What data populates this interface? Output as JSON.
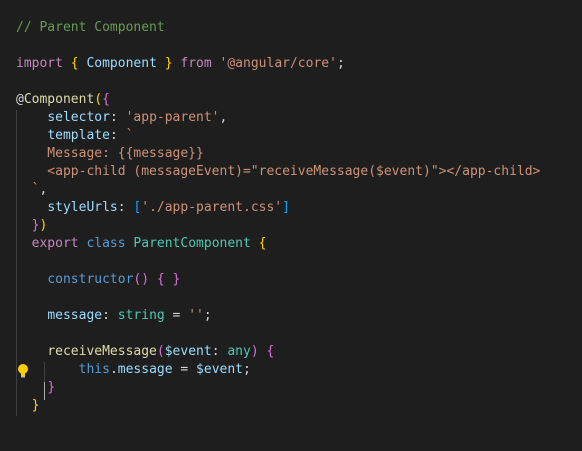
{
  "editor": {
    "lines": [
      {
        "id": "l1",
        "tokens": [
          {
            "t": "// Parent Component",
            "c": "comment"
          }
        ]
      },
      {
        "id": "l2",
        "tokens": []
      },
      {
        "id": "l3",
        "tokens": [
          {
            "t": "import",
            "c": "keyword"
          },
          {
            "t": " ",
            "c": "punct"
          },
          {
            "t": "{",
            "c": "brace-gold"
          },
          {
            "t": " ",
            "c": "punct"
          },
          {
            "t": "Component",
            "c": "var"
          },
          {
            "t": " ",
            "c": "punct"
          },
          {
            "t": "}",
            "c": "brace-gold"
          },
          {
            "t": " ",
            "c": "punct"
          },
          {
            "t": "from",
            "c": "keyword"
          },
          {
            "t": " ",
            "c": "punct"
          },
          {
            "t": "'@angular/core'",
            "c": "string"
          },
          {
            "t": ";",
            "c": "punct"
          }
        ]
      },
      {
        "id": "l4",
        "tokens": []
      },
      {
        "id": "l5",
        "tokens": [
          {
            "t": "@",
            "c": "punct"
          },
          {
            "t": "Component",
            "c": "decorator"
          },
          {
            "t": "(",
            "c": "brace-gold"
          },
          {
            "t": "{",
            "c": "brace-purple"
          }
        ]
      },
      {
        "id": "l6",
        "tokens": [
          {
            "t": "    ",
            "c": "punct"
          },
          {
            "t": "selector",
            "c": "var"
          },
          {
            "t": ": ",
            "c": "punct"
          },
          {
            "t": "'app-parent'",
            "c": "string"
          },
          {
            "t": ",",
            "c": "punct"
          }
        ]
      },
      {
        "id": "l7",
        "tokens": [
          {
            "t": "    ",
            "c": "punct"
          },
          {
            "t": "template",
            "c": "var"
          },
          {
            "t": ": ",
            "c": "punct"
          },
          {
            "t": "`",
            "c": "string"
          }
        ]
      },
      {
        "id": "l8",
        "tokens": [
          {
            "t": "    Message: {{message}}",
            "c": "string"
          }
        ]
      },
      {
        "id": "l9",
        "tokens": [
          {
            "t": "    <app-child (messageEvent)=\"receiveMessage($event)\"></app-child>",
            "c": "string"
          }
        ]
      },
      {
        "id": "l10",
        "tokens": [
          {
            "t": "  `",
            "c": "string"
          },
          {
            "t": ",",
            "c": "punct"
          }
        ]
      },
      {
        "id": "l11",
        "tokens": [
          {
            "t": "    ",
            "c": "punct"
          },
          {
            "t": "styleUrls",
            "c": "var"
          },
          {
            "t": ": ",
            "c": "punct"
          },
          {
            "t": "[",
            "c": "brace-blue"
          },
          {
            "t": "'./app-parent.css'",
            "c": "string"
          },
          {
            "t": "]",
            "c": "brace-blue"
          }
        ]
      },
      {
        "id": "l12",
        "tokens": [
          {
            "t": "  ",
            "c": "punct"
          },
          {
            "t": "}",
            "c": "brace-purple"
          },
          {
            "t": ")",
            "c": "brace-gold"
          }
        ]
      },
      {
        "id": "l13",
        "tokens": [
          {
            "t": "  ",
            "c": "punct"
          },
          {
            "t": "export",
            "c": "keyword"
          },
          {
            "t": " ",
            "c": "punct"
          },
          {
            "t": "class",
            "c": "storage"
          },
          {
            "t": " ",
            "c": "punct"
          },
          {
            "t": "ParentComponent",
            "c": "class"
          },
          {
            "t": " ",
            "c": "punct"
          },
          {
            "t": "{",
            "c": "brace-gold"
          }
        ]
      },
      {
        "id": "l14",
        "tokens": []
      },
      {
        "id": "l15",
        "tokens": [
          {
            "t": "    ",
            "c": "punct"
          },
          {
            "t": "constructor",
            "c": "storage"
          },
          {
            "t": "()",
            "c": "brace-purple"
          },
          {
            "t": " ",
            "c": "punct"
          },
          {
            "t": "{",
            "c": "brace-purple"
          },
          {
            "t": " ",
            "c": "punct"
          },
          {
            "t": "}",
            "c": "brace-purple"
          }
        ]
      },
      {
        "id": "l16",
        "tokens": []
      },
      {
        "id": "l17",
        "tokens": [
          {
            "t": "    ",
            "c": "punct"
          },
          {
            "t": "message",
            "c": "var"
          },
          {
            "t": ": ",
            "c": "punct"
          },
          {
            "t": "string",
            "c": "class"
          },
          {
            "t": " = ",
            "c": "punct"
          },
          {
            "t": "''",
            "c": "string"
          },
          {
            "t": ";",
            "c": "punct"
          }
        ]
      },
      {
        "id": "l18",
        "tokens": []
      },
      {
        "id": "l19",
        "tokens": [
          {
            "t": "    ",
            "c": "punct"
          },
          {
            "t": "receiveMessage",
            "c": "fn"
          },
          {
            "t": "(",
            "c": "brace-purple"
          },
          {
            "t": "$event",
            "c": "var"
          },
          {
            "t": ": ",
            "c": "punct"
          },
          {
            "t": "any",
            "c": "class"
          },
          {
            "t": ")",
            "c": "brace-purple"
          },
          {
            "t": " ",
            "c": "punct"
          },
          {
            "t": "{",
            "c": "brace-purple"
          }
        ]
      },
      {
        "id": "l20",
        "tokens": [
          {
            "t": "        ",
            "c": "punct"
          },
          {
            "t": "this",
            "c": "storage"
          },
          {
            "t": ".",
            "c": "punct"
          },
          {
            "t": "message",
            "c": "var"
          },
          {
            "t": " = ",
            "c": "punct"
          },
          {
            "t": "$event",
            "c": "var"
          },
          {
            "t": ";",
            "c": "punct"
          }
        ]
      },
      {
        "id": "l21",
        "tokens": [
          {
            "t": "    ",
            "c": "punct"
          },
          {
            "t": "}",
            "c": "brace-purple"
          }
        ]
      },
      {
        "id": "l22",
        "tokens": [
          {
            "t": "  ",
            "c": "punct"
          },
          {
            "t": "}",
            "c": "brace-gold"
          }
        ]
      }
    ]
  },
  "icons": {
    "lightbulb": "lightbulb-icon"
  },
  "colors": {
    "background": "#1e1e1e",
    "comment": "#6a9955",
    "keyword": "#c586c0",
    "storage": "#569cd6",
    "class": "#4ec9b0",
    "function": "#dcdcaa",
    "variable": "#9cdcfe",
    "string": "#ce9178",
    "bulb": "#ffcc00"
  }
}
